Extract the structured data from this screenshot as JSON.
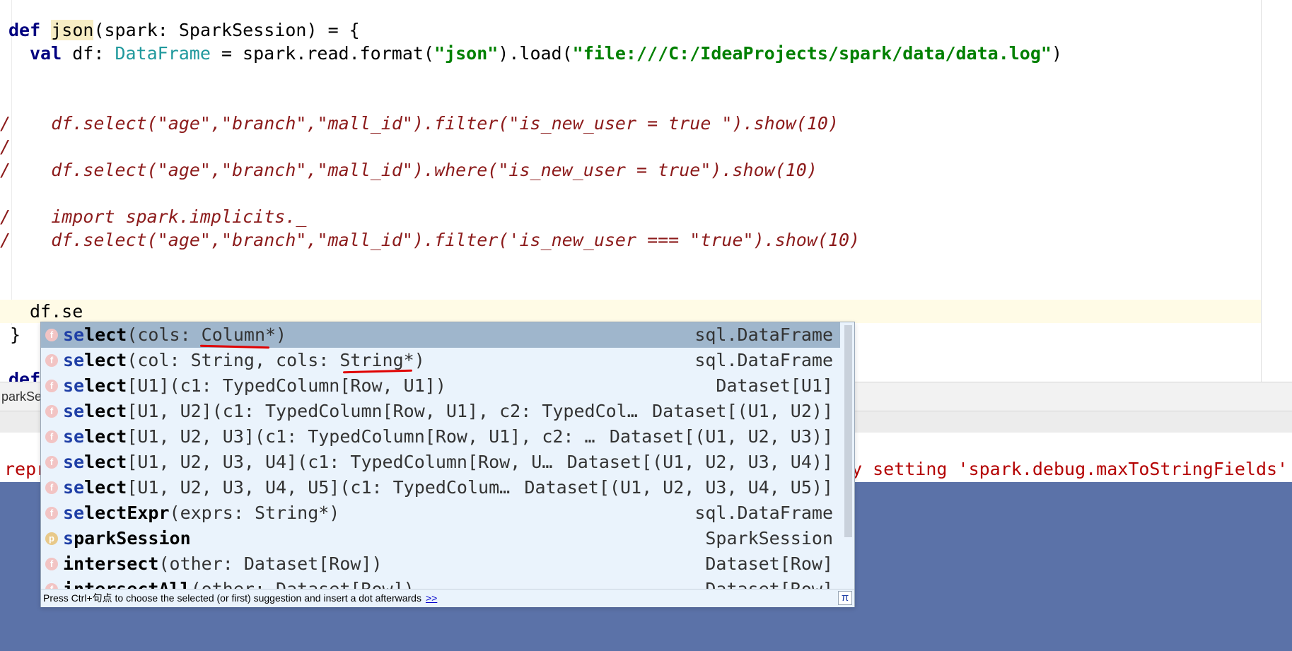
{
  "code": {
    "line_def_kw": "def",
    "line_def_name": "json",
    "line_def_rest": "(spark: SparkSession) = {",
    "line_val_kw": "val",
    "line_val_var": "df",
    "line_val_colon": ": ",
    "line_val_type": "DataFrame",
    "line_val_mid": " = spark.read.format(",
    "line_val_str1": "\"json\"",
    "line_val_mid2": ").load(",
    "line_val_str2": "\"file:///C:/IdeaProjects/spark/data/data.log\"",
    "line_val_end": ")",
    "comment1": "    df.select(\"age\",\"branch\",\"mall_id\").filter(\"is_new_user = true \").show(10)",
    "comment2": "    df.select(\"age\",\"branch\",\"mall_id\").where(\"is_new_user = true\").show(10)",
    "comment3": "    import spark.implicits._",
    "comment4": "    df.select(\"age\",\"branch\",\"mall_id\").filter('is_new_user === \"true\").show(10)",
    "comment_marker": "/",
    "current_line": "df.se",
    "closing_brace": "}",
    "next_def_partial": "def"
  },
  "tab_partial": "parkSe",
  "console": {
    "left_partial": "repr",
    "right_partial": "y setting 'spark.debug.maxToStringFields'"
  },
  "completion": {
    "items": [
      {
        "badge": "f",
        "match": "se",
        "rest": "lect",
        "sig": "(cols: Column*)",
        "ret": "sql.DataFrame"
      },
      {
        "badge": "f",
        "match": "se",
        "rest": "lect",
        "sig": "(col: String, cols: String*)",
        "ret": "sql.DataFrame"
      },
      {
        "badge": "f",
        "match": "se",
        "rest": "lect",
        "sig": "[U1](c1: TypedColumn[Row, U1])",
        "ret": "Dataset[U1]"
      },
      {
        "badge": "f",
        "match": "se",
        "rest": "lect",
        "sig": "[U1, U2](c1: TypedColumn[Row, U1], c2: TypedCol…",
        "ret": "Dataset[(U1, U2)]"
      },
      {
        "badge": "f",
        "match": "se",
        "rest": "lect",
        "sig": "[U1, U2, U3](c1: TypedColumn[Row, U1], c2: …",
        "ret": "Dataset[(U1, U2, U3)]"
      },
      {
        "badge": "f",
        "match": "se",
        "rest": "lect",
        "sig": "[U1, U2, U3, U4](c1: TypedColumn[Row, U…",
        "ret": "Dataset[(U1, U2, U3, U4)]"
      },
      {
        "badge": "f",
        "match": "se",
        "rest": "lect",
        "sig": "[U1, U2, U3, U4, U5](c1: TypedColum…",
        "ret": "Dataset[(U1, U2, U3, U4, U5)]"
      },
      {
        "badge": "f",
        "match": "se",
        "rest": "lectExpr",
        "sig": "(exprs: String*)",
        "ret": "sql.DataFrame"
      },
      {
        "badge": "p",
        "match": "s",
        "rest": "parkSession",
        "sig": "",
        "ret": "SparkSession"
      },
      {
        "badge": "f",
        "match": "",
        "rest": "intersect",
        "sig": "(other: Dataset[Row])",
        "ret": "Dataset[Row]"
      },
      {
        "badge": "f",
        "match": "",
        "rest": "intersectAll",
        "sig": "(other: Dataset[Row])",
        "ret": "Dataset[Row]"
      }
    ],
    "footer_text": "Press Ctrl+句点 to choose the selected (or first) suggestion and insert a dot afterwards",
    "footer_link": ">>",
    "footer_icon": "π"
  },
  "colors": {
    "keyword": "#000080",
    "string": "#008000",
    "comment": "#8c1b1b",
    "type": "#20999d",
    "selection": "#9fb6cc",
    "popup_bg": "#eaf3fc",
    "panel_blue": "#5b72a8"
  }
}
